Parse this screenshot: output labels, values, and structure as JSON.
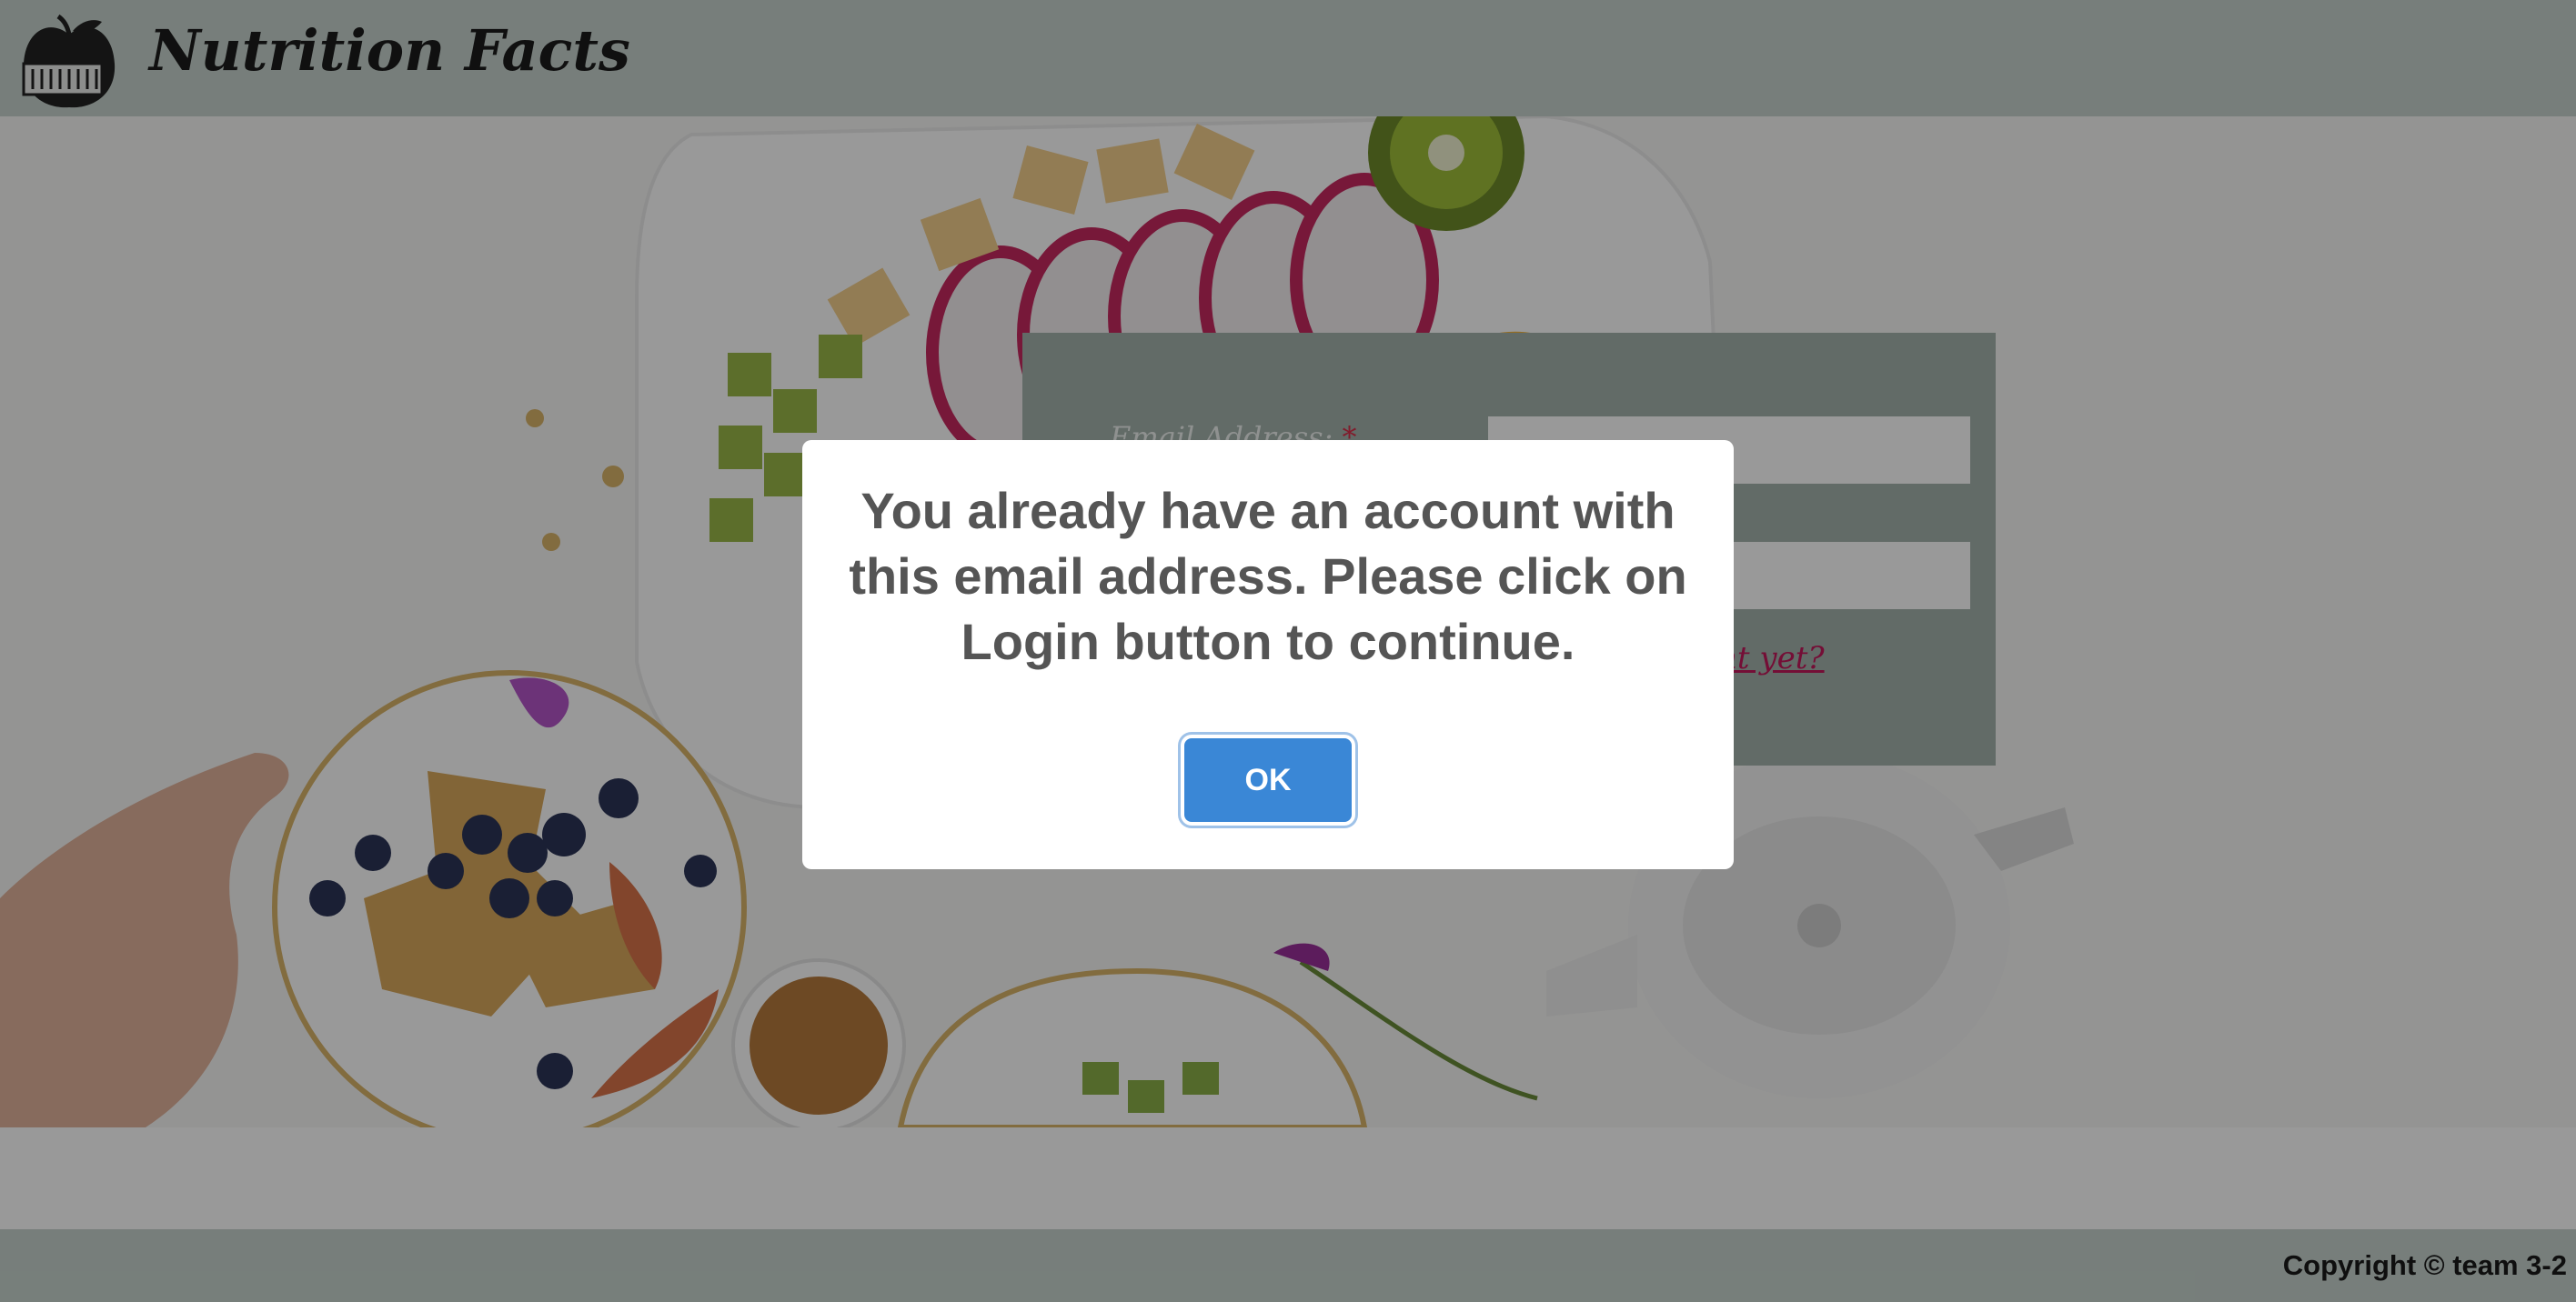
{
  "header": {
    "title": "Nutrition Facts",
    "logo_icon": "apple-scale-icon"
  },
  "login_form": {
    "email_label": "Email Address:",
    "required_mark": "*",
    "signup_link_visible_text": "nt yet?"
  },
  "footer": {
    "copyright": "Copyright © team 3-2"
  },
  "dialog": {
    "message": "You already have an account with this email address. Please click on Login button to continue.",
    "ok_label": "OK"
  },
  "colors": {
    "header_bg": "#c7d3cd",
    "panel_bg": "#a3b3ac",
    "ok_button": "#3a87d6",
    "link": "#c2185b"
  }
}
